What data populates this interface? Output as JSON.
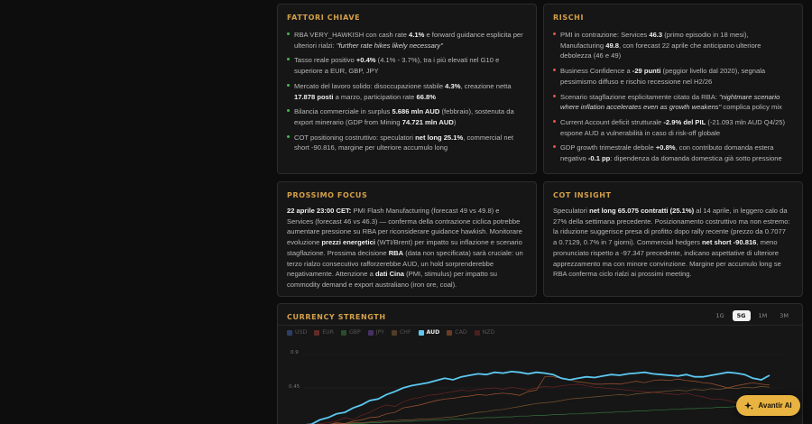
{
  "cards": {
    "fattori": {
      "title": "FATTORI CHIAVE",
      "items": [
        [
          {
            "t": "RBA VERY_HAWKISH con cash rate "
          },
          {
            "b": "4.1%"
          },
          {
            "t": " e forward guidance esplicita per ulteriori rialzi: "
          },
          {
            "i": "\"further rate hikes likely necessary\""
          }
        ],
        [
          {
            "t": "Tasso reale positivo "
          },
          {
            "b": "+0.4%"
          },
          {
            "t": " (4.1% - 3.7%), tra i più elevati nel G10 e superiore a EUR, GBP, JPY"
          }
        ],
        [
          {
            "t": "Mercato del lavoro solido: disoccupazione stabile "
          },
          {
            "b": "4.3%"
          },
          {
            "t": ", creazione netta "
          },
          {
            "b": "17.878 posti"
          },
          {
            "t": " a marzo, participation rate "
          },
          {
            "b": "66.8%"
          }
        ],
        [
          {
            "t": "Bilancia commerciale in surplus "
          },
          {
            "b": "5.686 mln AUD"
          },
          {
            "t": " (febbraio), sostenuta da export minerario (GDP from Mining "
          },
          {
            "b": "74.721 mln AUD"
          },
          {
            "t": ")"
          }
        ],
        [
          {
            "t": "COT positioning costruttivo: speculatori "
          },
          {
            "b": "net long 25.1%"
          },
          {
            "t": ", commercial net short -90.816, margine per ulteriore accumulo long"
          }
        ]
      ]
    },
    "rischi": {
      "title": "RISCHI",
      "items": [
        [
          {
            "t": "PMI in contrazione: Services "
          },
          {
            "b": "46.3"
          },
          {
            "t": " (primo episodio in 18 mesi), Manufacturing "
          },
          {
            "b": "49.8"
          },
          {
            "t": ", con forecast 22 aprile che anticipano ulteriore debolezza (46 e 49)"
          }
        ],
        [
          {
            "t": "Business Confidence a "
          },
          {
            "b": "-29 punti"
          },
          {
            "t": " (peggior livello dal 2020), segnala pessimismo diffuso e rischio recessione nel H2/26"
          }
        ],
        [
          {
            "t": "Scenario stagflazione esplicitamente citato da RBA: "
          },
          {
            "i": "\"nightmare scenario where inflation accelerates even as growth weakens\""
          },
          {
            "t": " complica policy mix"
          }
        ],
        [
          {
            "t": "Current Account deficit strutturale "
          },
          {
            "b": "-2.9% del PIL"
          },
          {
            "t": " (-21.093 mln AUD Q4/25) espone AUD a vulnerabilità in caso di risk-off globale"
          }
        ],
        [
          {
            "t": "GDP growth trimestrale debole "
          },
          {
            "b": "+0.8%"
          },
          {
            "t": ", con contributo domanda estera negativo "
          },
          {
            "b": "-0.1 pp"
          },
          {
            "t": ": dipendenza da domanda domestica già sotto pressione"
          }
        ]
      ]
    },
    "focus": {
      "title": "PROSSIMO FOCUS",
      "body": [
        {
          "b": "22 aprile 23:00 CET:"
        },
        {
          "t": " PMI Flash Manufacturing (forecast 49 vs 49.8) e Services (forecast 46 vs 46.3) — conferma della contrazione ciclica potrebbe aumentare pressione su RBA per riconsiderare guidance hawkish. Monitorare evoluzione "
        },
        {
          "b": "prezzi energetici"
        },
        {
          "t": " (WTI/Brent) per impatto su inflazione e scenario stagflazione. Prossima decisione "
        },
        {
          "b": "RBA"
        },
        {
          "t": " (data non specificata) sarà cruciale: un terzo rialzo consecutivo rafforzerebbe AUD, un hold sorprenderebbe negativamente. Attenzione a "
        },
        {
          "b": "dati Cina"
        },
        {
          "t": " (PMI, stimulus) per impatto su commodity demand e export australiano (iron ore, coal)."
        }
      ]
    },
    "cot": {
      "title": "COT INSIGHT",
      "body": [
        {
          "t": "Speculatori "
        },
        {
          "b": "net long 65.075 contratti (25.1%)"
        },
        {
          "t": " al 14 aprile, in leggero calo da 27% della settimana precedente. Posizionamento costruttivo ma non estremo: la riduzione suggerisce presa di profitto dopo rally recente (prezzo da 0.7077 a 0.7129, 0.7% in 7 giorni). Commercial hedgers "
        },
        {
          "b": "net short -90.816"
        },
        {
          "t": ", meno pronunciato rispetto a -97.347 precedente, indicano aspettative di ulteriore apprezzamento ma con minore convinzione. Margine per accumulo long se RBA conferma ciclo rialzi ai prossimi meeting."
        }
      ]
    }
  },
  "strength": {
    "title": "CURRENCY STRENGTH",
    "timeframes": [
      "1G",
      "5G",
      "1M",
      "3M"
    ],
    "active_timeframe": "5G",
    "legend": [
      {
        "label": "USD",
        "color": "#4a72c8",
        "active": false
      },
      {
        "label": "EUR",
        "color": "#c0443c",
        "active": false
      },
      {
        "label": "GBP",
        "color": "#3f8f4a",
        "active": false
      },
      {
        "label": "JPY",
        "color": "#7d55c4",
        "active": false
      },
      {
        "label": "CHF",
        "color": "#9a6a3a",
        "active": false
      },
      {
        "label": "AUD",
        "color": "#5cc8f0",
        "active": true
      },
      {
        "label": "CAD",
        "color": "#d06a3a",
        "active": false
      },
      {
        "label": "NZD",
        "color": "#8a2a2a",
        "active": false
      }
    ],
    "y_ticks": [
      "0.9",
      "0.45"
    ]
  },
  "chart_data": {
    "type": "line",
    "ylim": [
      -0.05,
      0.9
    ],
    "series": [
      {
        "name": "AUD",
        "color": "#5cc8f0",
        "values": [
          -0.05,
          -0.04,
          0.02,
          0.05,
          0.1,
          0.12,
          0.18,
          0.22,
          0.28,
          0.3,
          0.36,
          0.4,
          0.45,
          0.48,
          0.5,
          0.52,
          0.55,
          0.58,
          0.56,
          0.6,
          0.62,
          0.64,
          0.63,
          0.66,
          0.65,
          0.67,
          0.66,
          0.64,
          0.66,
          0.65,
          0.63,
          0.58,
          0.56,
          0.58,
          0.6,
          0.59,
          0.61,
          0.63,
          0.62,
          0.64,
          0.65,
          0.66,
          0.64,
          0.63,
          0.62,
          0.61,
          0.63,
          0.6,
          0.6,
          0.62,
          0.64,
          0.66,
          0.65,
          0.63,
          0.58,
          0.56,
          0.62
        ]
      },
      {
        "name": "NZD",
        "color": "#8a2a2a",
        "values": [
          -0.05,
          -0.05,
          -0.03,
          -0.02,
          0.0,
          0.05,
          0.02,
          0.08,
          0.12,
          0.18,
          0.22,
          0.2,
          0.26,
          0.3,
          0.32,
          0.35,
          0.36,
          0.38,
          0.4,
          0.42,
          0.41,
          0.43,
          0.44,
          0.45,
          0.43,
          0.46,
          0.44,
          0.42,
          0.45,
          0.47,
          0.46,
          0.48,
          0.49,
          0.5,
          0.48,
          0.46,
          0.45,
          0.44,
          0.43,
          0.42,
          0.41,
          0.4,
          0.39,
          0.38,
          0.37,
          0.36,
          0.38,
          0.35,
          0.33,
          0.3,
          0.3,
          0.28,
          0.25,
          0.3,
          0.28,
          0.31,
          0.33
        ]
      },
      {
        "name": "CAD",
        "color": "#d06a3a",
        "values": [
          -0.05,
          -0.06,
          -0.04,
          -0.05,
          -0.02,
          -0.03,
          0.0,
          0.02,
          0.05,
          0.06,
          0.1,
          0.12,
          0.18,
          0.2,
          0.22,
          0.25,
          0.28,
          0.3,
          0.31,
          0.33,
          0.34,
          0.36,
          0.35,
          0.37,
          0.38,
          0.37,
          0.35,
          0.4,
          0.42,
          0.6,
          0.6,
          0.58,
          0.56,
          0.53,
          0.52,
          0.5,
          0.5,
          0.51,
          0.5,
          0.52,
          0.54,
          0.52,
          0.55,
          0.56,
          0.55,
          0.57,
          0.55,
          0.54,
          0.52,
          0.51,
          0.48,
          0.45,
          0.48,
          0.5,
          0.52,
          0.5,
          0.49
        ]
      },
      {
        "name": "CHF",
        "color": "#9a6a3a",
        "values": [
          -0.05,
          -0.05,
          -0.04,
          -0.04,
          -0.03,
          -0.03,
          -0.02,
          -0.02,
          -0.01,
          0.0,
          0.0,
          0.01,
          0.02,
          0.02,
          0.03,
          0.03,
          0.04,
          0.05,
          0.06,
          0.08,
          0.1,
          0.12,
          0.13,
          0.15,
          0.16,
          0.18,
          0.2,
          0.22,
          0.24,
          0.25,
          0.26,
          0.28,
          0.3,
          0.31,
          0.32,
          0.33,
          0.34,
          0.35,
          0.36,
          0.35,
          0.37,
          0.38,
          0.39,
          0.4,
          0.41,
          0.42,
          0.41,
          0.43,
          0.42,
          0.44,
          0.43,
          0.45,
          0.44,
          0.46,
          0.45,
          0.47,
          0.46
        ]
      },
      {
        "name": "GBP",
        "color": "#3f8f4a",
        "values": [
          -0.05,
          -0.05,
          -0.05,
          -0.04,
          -0.04,
          -0.04,
          -0.03,
          -0.03,
          -0.02,
          -0.02,
          -0.01,
          -0.01,
          0.0,
          0.0,
          0.01,
          0.01,
          0.02,
          0.02,
          0.03,
          0.03,
          0.04,
          0.04,
          0.05,
          0.05,
          0.06,
          0.06,
          0.07,
          0.07,
          0.08,
          0.08,
          0.09,
          0.09,
          0.1,
          0.1,
          0.11,
          0.11,
          0.12,
          0.12,
          0.13,
          0.13,
          0.14,
          0.14,
          0.15,
          0.15,
          0.16,
          0.16,
          0.17,
          0.17,
          0.18,
          0.18,
          0.19,
          0.19,
          0.2,
          0.2,
          0.21,
          0.21,
          0.22
        ]
      }
    ]
  },
  "ai_button": {
    "label": "Avantir AI",
    "icon": "sparkle-icon"
  }
}
